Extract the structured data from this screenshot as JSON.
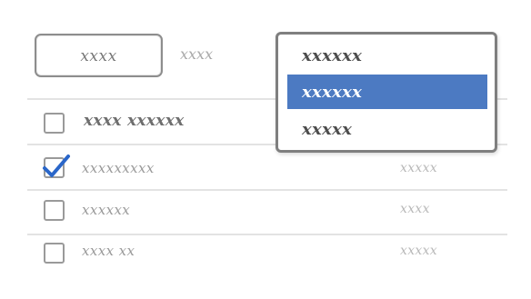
{
  "toolbar": {
    "button_label": "xxxx",
    "link_text": "xxxx"
  },
  "dropdown": {
    "items": [
      {
        "label": "xxxxxx"
      },
      {
        "label": "xxxxxx"
      },
      {
        "label": "xxxxx"
      }
    ],
    "selected_index": 1
  },
  "table": {
    "header_label": "xxxx xxxxxx",
    "rows": [
      {
        "name": "xxxxxxxxx",
        "value": "xxxxx",
        "checked": true
      },
      {
        "name": "xxxxxx",
        "value": "xxxx",
        "checked": false
      },
      {
        "name": "xxxx xx",
        "value": "xxxxx",
        "checked": false
      }
    ]
  },
  "colors": {
    "selection": "#4c7ac2",
    "check": "#2a66c9"
  }
}
